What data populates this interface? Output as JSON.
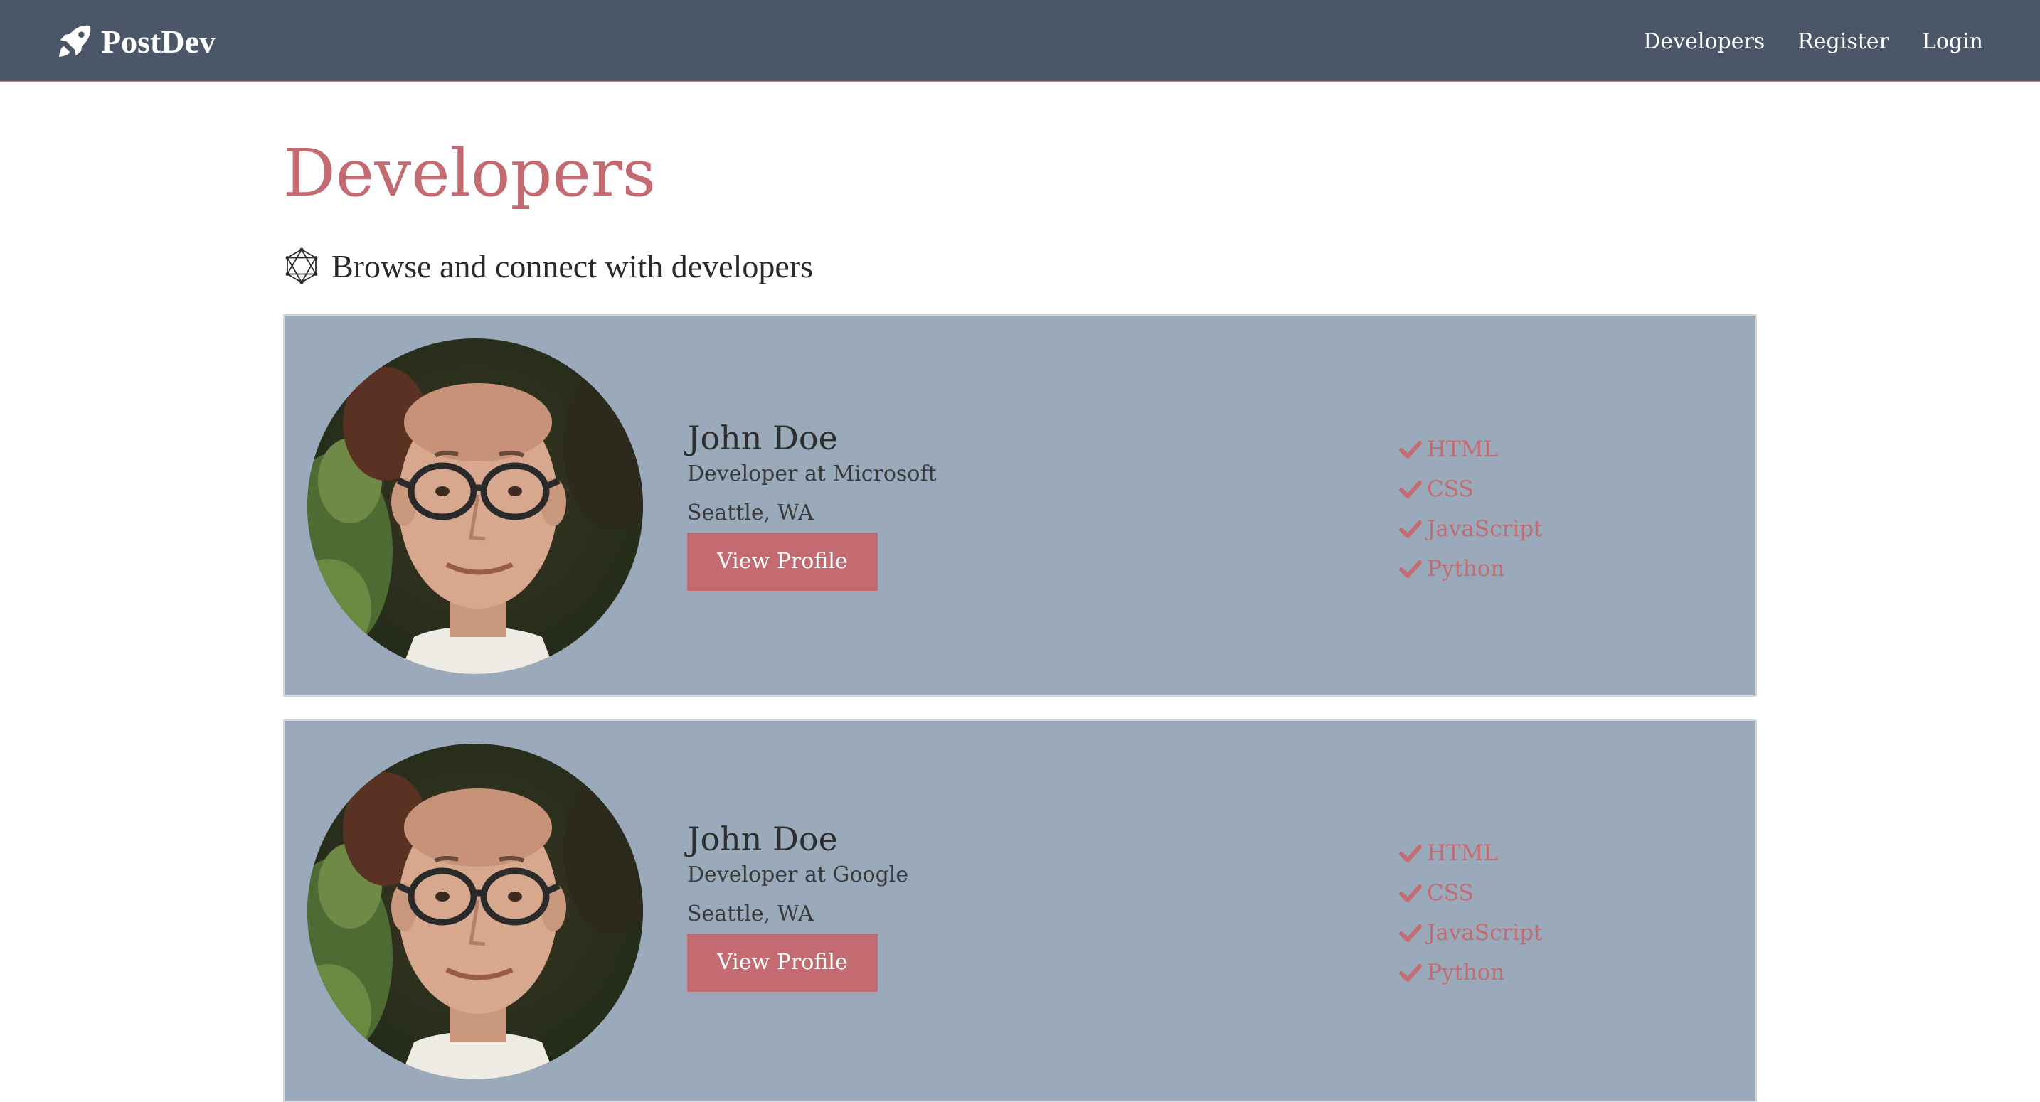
{
  "navbar": {
    "brand": "PostDev",
    "links": [
      {
        "label": "Developers"
      },
      {
        "label": "Register"
      },
      {
        "label": "Login"
      }
    ]
  },
  "page": {
    "title": "Developers",
    "lead": "Browse and connect with developers"
  },
  "profiles": [
    {
      "name": "John Doe",
      "role": "Developer at Microsoft",
      "location": "Seattle, WA",
      "button": "View Profile",
      "skills": [
        "HTML",
        "CSS",
        "JavaScript",
        "Python"
      ]
    },
    {
      "name": "John Doe",
      "role": "Developer at Google",
      "location": "Seattle, WA",
      "button": "View Profile",
      "skills": [
        "HTML",
        "CSS",
        "JavaScript",
        "Python"
      ]
    }
  ],
  "colors": {
    "navbar": "#4b5768",
    "accent": "#c36b70",
    "card": "#9aaabb"
  },
  "icons": {
    "brand": "rocket-icon",
    "lead": "connectdevelop-icon",
    "skill": "check-icon"
  }
}
